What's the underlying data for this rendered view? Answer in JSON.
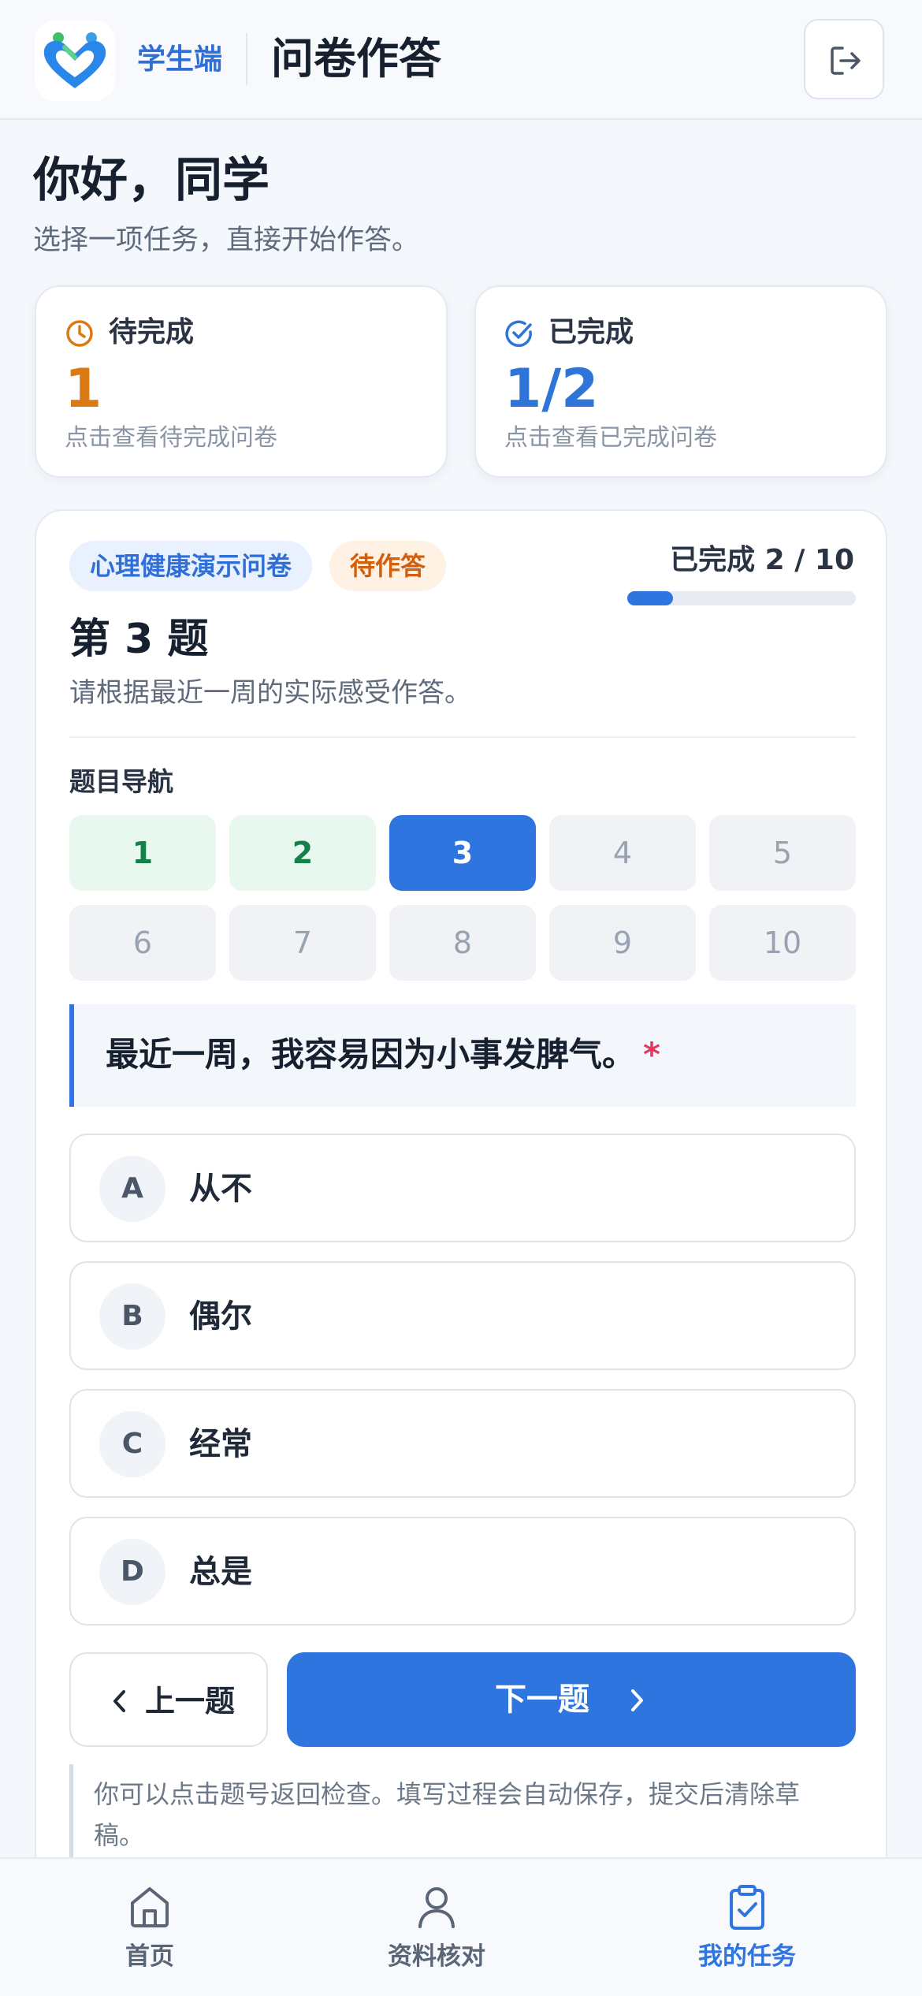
{
  "header": {
    "role_label": "学生端",
    "title": "问卷作答",
    "logo_icon": "heart-people-logo",
    "logout_icon": "logout-icon"
  },
  "greeting": {
    "title": "你好，同学",
    "subtitle": "选择一项任务，直接开始作答。"
  },
  "stats": {
    "pending": {
      "label": "待完成",
      "value": "1",
      "hint": "点击查看待完成问卷",
      "icon": "clock-icon"
    },
    "done": {
      "label": "已完成",
      "value": "1/2",
      "hint": "点击查看已完成问卷",
      "icon": "check-circle-icon"
    }
  },
  "survey": {
    "name": "心理健康演示问卷",
    "status": "待作答",
    "progress_text": "已完成 2 / 10",
    "answered": 2,
    "total": 10,
    "question_number": "第 3 题",
    "question_hint": "请根据最近一周的实际感受作答。",
    "nav_title": "题目导航",
    "nav": [
      {
        "label": "1",
        "state": "answered"
      },
      {
        "label": "2",
        "state": "answered"
      },
      {
        "label": "3",
        "state": "current"
      },
      {
        "label": "4",
        "state": "unanswered"
      },
      {
        "label": "5",
        "state": "unanswered"
      },
      {
        "label": "6",
        "state": "unanswered"
      },
      {
        "label": "7",
        "state": "unanswered"
      },
      {
        "label": "8",
        "state": "unanswered"
      },
      {
        "label": "9",
        "state": "unanswered"
      },
      {
        "label": "10",
        "state": "unanswered"
      }
    ],
    "question_text": "最近一周，我容易因为小事发脾气。",
    "required_mark": "*",
    "options": [
      {
        "letter": "A",
        "text": "从不"
      },
      {
        "letter": "B",
        "text": "偶尔"
      },
      {
        "letter": "C",
        "text": "经常"
      },
      {
        "letter": "D",
        "text": "总是"
      }
    ],
    "prev_label": "上一题",
    "next_label": "下一题",
    "tip": "你可以点击题号返回检查。填写过程会自动保存，提交后清除草稿。"
  },
  "bottom_nav": [
    {
      "label": "首页",
      "icon": "home-icon",
      "active": false
    },
    {
      "label": "资料核对",
      "icon": "person-icon",
      "active": false
    },
    {
      "label": "我的任务",
      "icon": "clipboard-check-icon",
      "active": true
    }
  ],
  "colors": {
    "primary": "#2f75e0",
    "pending": "#db7a13",
    "answered_bg": "#e8f8ee",
    "answered_text": "#14804a",
    "required": "#e23a5e"
  }
}
